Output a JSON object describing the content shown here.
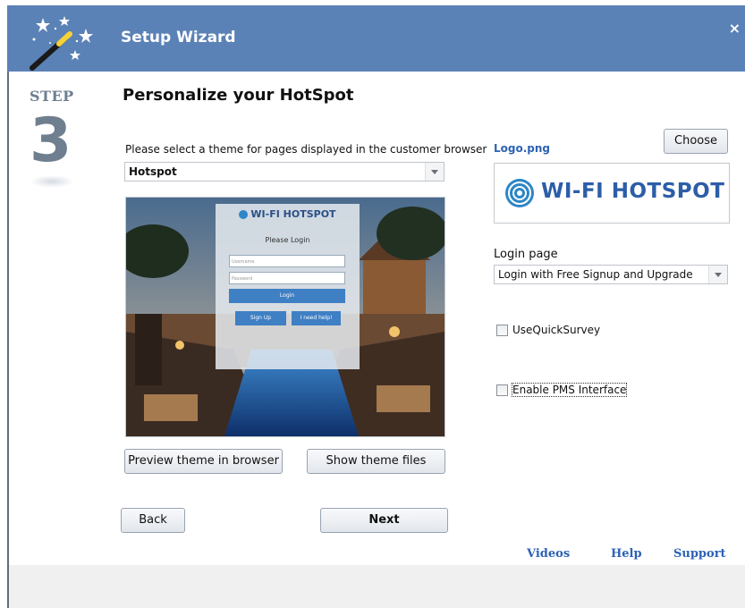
{
  "window": {
    "title": "Setup Wizard",
    "close": "×"
  },
  "step": {
    "label": "STEP",
    "number": "3"
  },
  "heading": "Personalize your HotSpot",
  "theme": {
    "label": "Please select a theme for pages displayed in the customer browser",
    "selected": "Hotspot"
  },
  "preview": {
    "brand": "WI-FI HOTSPOT",
    "please_login": "Please Login",
    "username_placeholder": "Username",
    "password_placeholder": "Password",
    "login_button": "Login",
    "signup_button": "Sign Up",
    "help_button": "I need help!"
  },
  "buttons": {
    "preview_theme": "Preview theme in browser",
    "show_files": "Show theme files",
    "back": "Back",
    "next": "Next",
    "choose": "Choose"
  },
  "logo": {
    "filename": "Logo.png",
    "text": "WI-FI HOTSPOT"
  },
  "login_page": {
    "label": "Login page",
    "selected": "Login with Free Signup and Upgrade"
  },
  "options": {
    "quick_survey": "UseQuickSurvey",
    "pms": "Enable PMS Interface"
  },
  "links": {
    "videos": "Videos",
    "help": "Help",
    "support": "Support"
  },
  "colors": {
    "header": "#5b82b6",
    "link": "#2d62b5",
    "step": "#6f7f90",
    "pool": "#1d4f8f"
  },
  "icons": {
    "wand": "magic-wand-icon",
    "wifi": "wifi-signal-icon",
    "dropdown": "chevron-down-icon"
  }
}
